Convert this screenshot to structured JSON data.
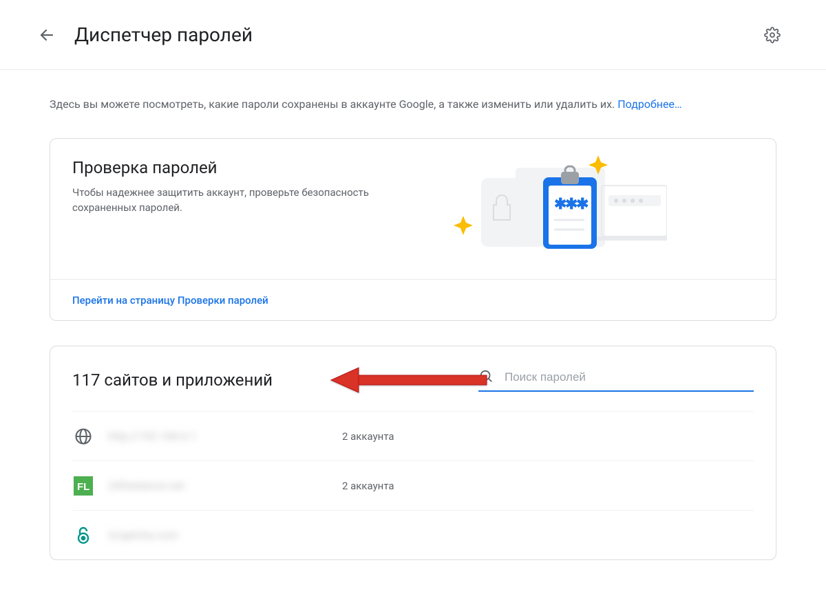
{
  "header": {
    "title": "Диспетчер паролей"
  },
  "intro": {
    "text": "Здесь вы можете посмотреть, какие пароли сохранены в аккаунте Google, а также изменить или удалить их. ",
    "link": "Подробнее…"
  },
  "checkup": {
    "title": "Проверка паролей",
    "desc": "Чтобы надежнее защитить аккаунт, проверьте безопасность сохраненных паролей.",
    "action": "Перейти на страницу Проверки паролей"
  },
  "list": {
    "title": "117 сайтов и приложений",
    "search_placeholder": "Поиск паролей"
  },
  "rows": [
    {
      "icon": "globe",
      "name": "http://192.168.0.1",
      "count": "2 аккаунта"
    },
    {
      "icon": "fl",
      "name": "24freelance.net",
      "count": "2 аккаунта"
    },
    {
      "icon": "lock-teal",
      "name": "2captcha.com",
      "count": ""
    }
  ]
}
